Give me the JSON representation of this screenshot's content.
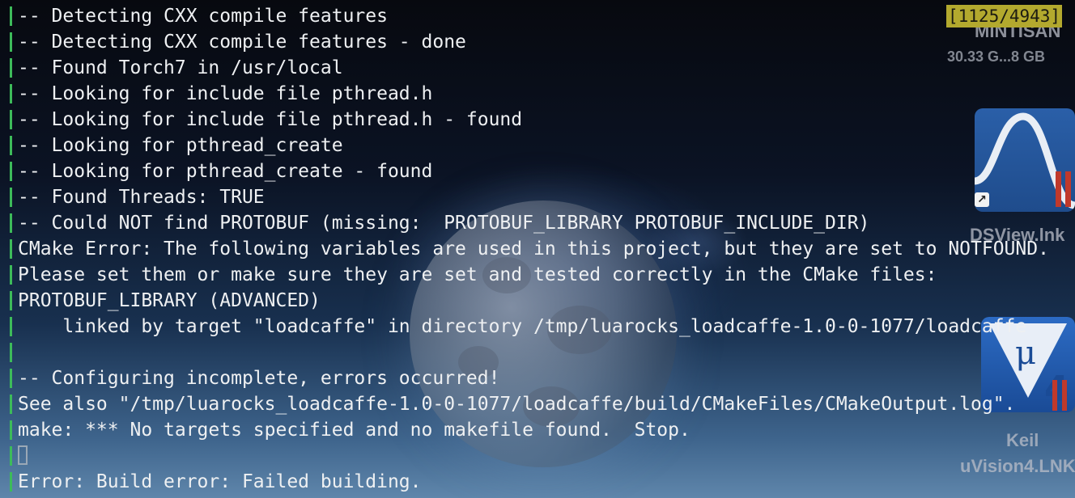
{
  "terminal": {
    "counter": "[1125/4943]",
    "lines": [
      "-- Detecting CXX compile features",
      "-- Detecting CXX compile features - done",
      "-- Found Torch7 in /usr/local",
      "-- Looking for include file pthread.h",
      "-- Looking for include file pthread.h - found",
      "-- Looking for pthread_create",
      "-- Looking for pthread_create - found",
      "-- Found Threads: TRUE",
      "-- Could NOT find PROTOBUF (missing:  PROTOBUF_LIBRARY PROTOBUF_INCLUDE_DIR)",
      "CMake Error: The following variables are used in this project, but they are set to NOTFOUND.",
      "Please set them or make sure they are set and tested correctly in the CMake files:",
      "PROTOBUF_LIBRARY (ADVANCED)",
      "    linked by target \"loadcaffe\" in directory /tmp/luarocks_loadcaffe-1.0-0-1077/loadcaffe",
      "",
      "-- Configuring incomplete, errors occurred!",
      "See also \"/tmp/luarocks_loadcaffe-1.0-0-1077/loadcaffe/build/CMakeFiles/CMakeOutput.log\".",
      "make: *** No targets specified and no makefile found.  Stop.",
      "",
      "Error: Build error: Failed building."
    ]
  },
  "desktop": {
    "volume_name": "MINTISAN",
    "volume_size": "30.33 G...8 GB",
    "dsview_label": "DSView.lnk",
    "keil_label_1": "Keil",
    "keil_label_2": "uVision4.LNK"
  },
  "colors": {
    "gutter": "#3dbb5a",
    "text": "#eef0f2",
    "counter_bg": "#b3a92e"
  }
}
